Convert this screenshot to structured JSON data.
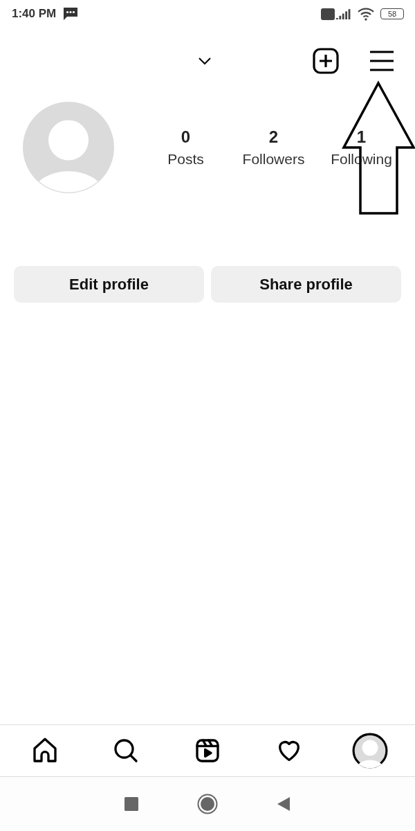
{
  "status_bar": {
    "time": "1:40 PM",
    "battery": "58"
  },
  "stats": [
    {
      "count": "0",
      "label": "Posts"
    },
    {
      "count": "2",
      "label": "Followers"
    },
    {
      "count": "1",
      "label": "Following"
    }
  ],
  "buttons": [
    "Edit profile",
    "Share profile"
  ],
  "bottom_nav": [
    {
      "kind": "home",
      "selected": false
    },
    {
      "kind": "search",
      "selected": false
    },
    {
      "kind": "reels",
      "selected": false
    },
    {
      "kind": "activity",
      "selected": false
    },
    {
      "kind": "profile",
      "selected": true
    }
  ]
}
